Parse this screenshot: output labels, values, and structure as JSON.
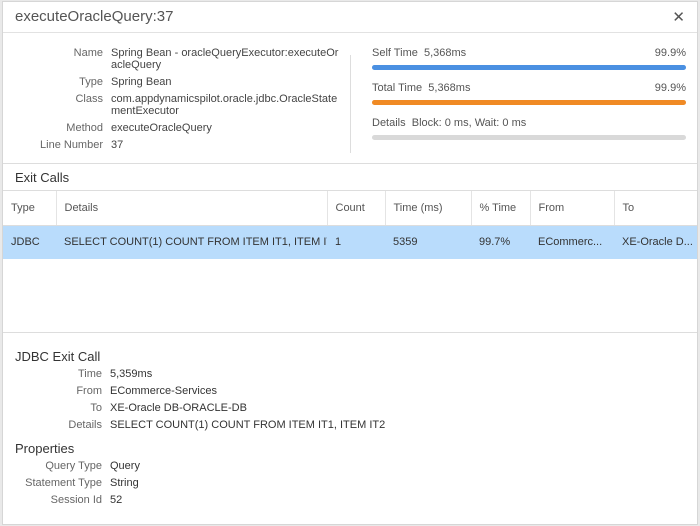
{
  "title": "executeOracleQuery:37",
  "close_icon": "close-icon",
  "info": [
    {
      "label": "Name",
      "value": "Spring Bean - oracleQueryExecutor:executeOracleQuery"
    },
    {
      "label": "Type",
      "value": "Spring Bean"
    },
    {
      "label": "Class",
      "value": "com.appdynamicspilot.oracle.jdbc.OracleStatementExecutor"
    },
    {
      "label": "Method",
      "value": "executeOracleQuery"
    },
    {
      "label": "Line Number",
      "value": "37"
    }
  ],
  "metrics": {
    "self": {
      "label": "Self Time",
      "value": "5,368ms",
      "percent": "99.9%",
      "fill": 99.9,
      "color": "#4a90e2"
    },
    "total": {
      "label": "Total Time",
      "value": "5,368ms",
      "percent": "99.9%",
      "fill": 99.9,
      "color": "#f08a24"
    },
    "details": {
      "label": "Details",
      "value": "Block: 0 ms, Wait: 0 ms",
      "fill": 0,
      "color": "#d9d9d9"
    }
  },
  "exit_calls": {
    "title": "Exit Calls",
    "columns": [
      "Type",
      "Details",
      "Count",
      "Time (ms)",
      "% Time",
      "From",
      "To"
    ],
    "rows": [
      [
        "JDBC",
        "SELECT COUNT(1) COUNT FROM ITEM IT1, ITEM IT2",
        "1",
        "5359",
        "99.7%",
        "ECommerc...",
        "XE-Oracle D..."
      ]
    ]
  },
  "jdbc": {
    "title": "JDBC Exit Call",
    "fields": [
      {
        "label": "Time",
        "value": "5,359ms"
      },
      {
        "label": "From",
        "value": "ECommerce-Services"
      },
      {
        "label": "To",
        "value": "XE-Oracle DB-ORACLE-DB"
      },
      {
        "label": "Details",
        "value": "SELECT COUNT(1) COUNT FROM ITEM IT1, ITEM IT2"
      }
    ]
  },
  "properties": {
    "title": "Properties",
    "fields": [
      {
        "label": "Query Type",
        "value": "Query"
      },
      {
        "label": "Statement Type",
        "value": "String"
      },
      {
        "label": "Session Id",
        "value": "52"
      }
    ]
  }
}
